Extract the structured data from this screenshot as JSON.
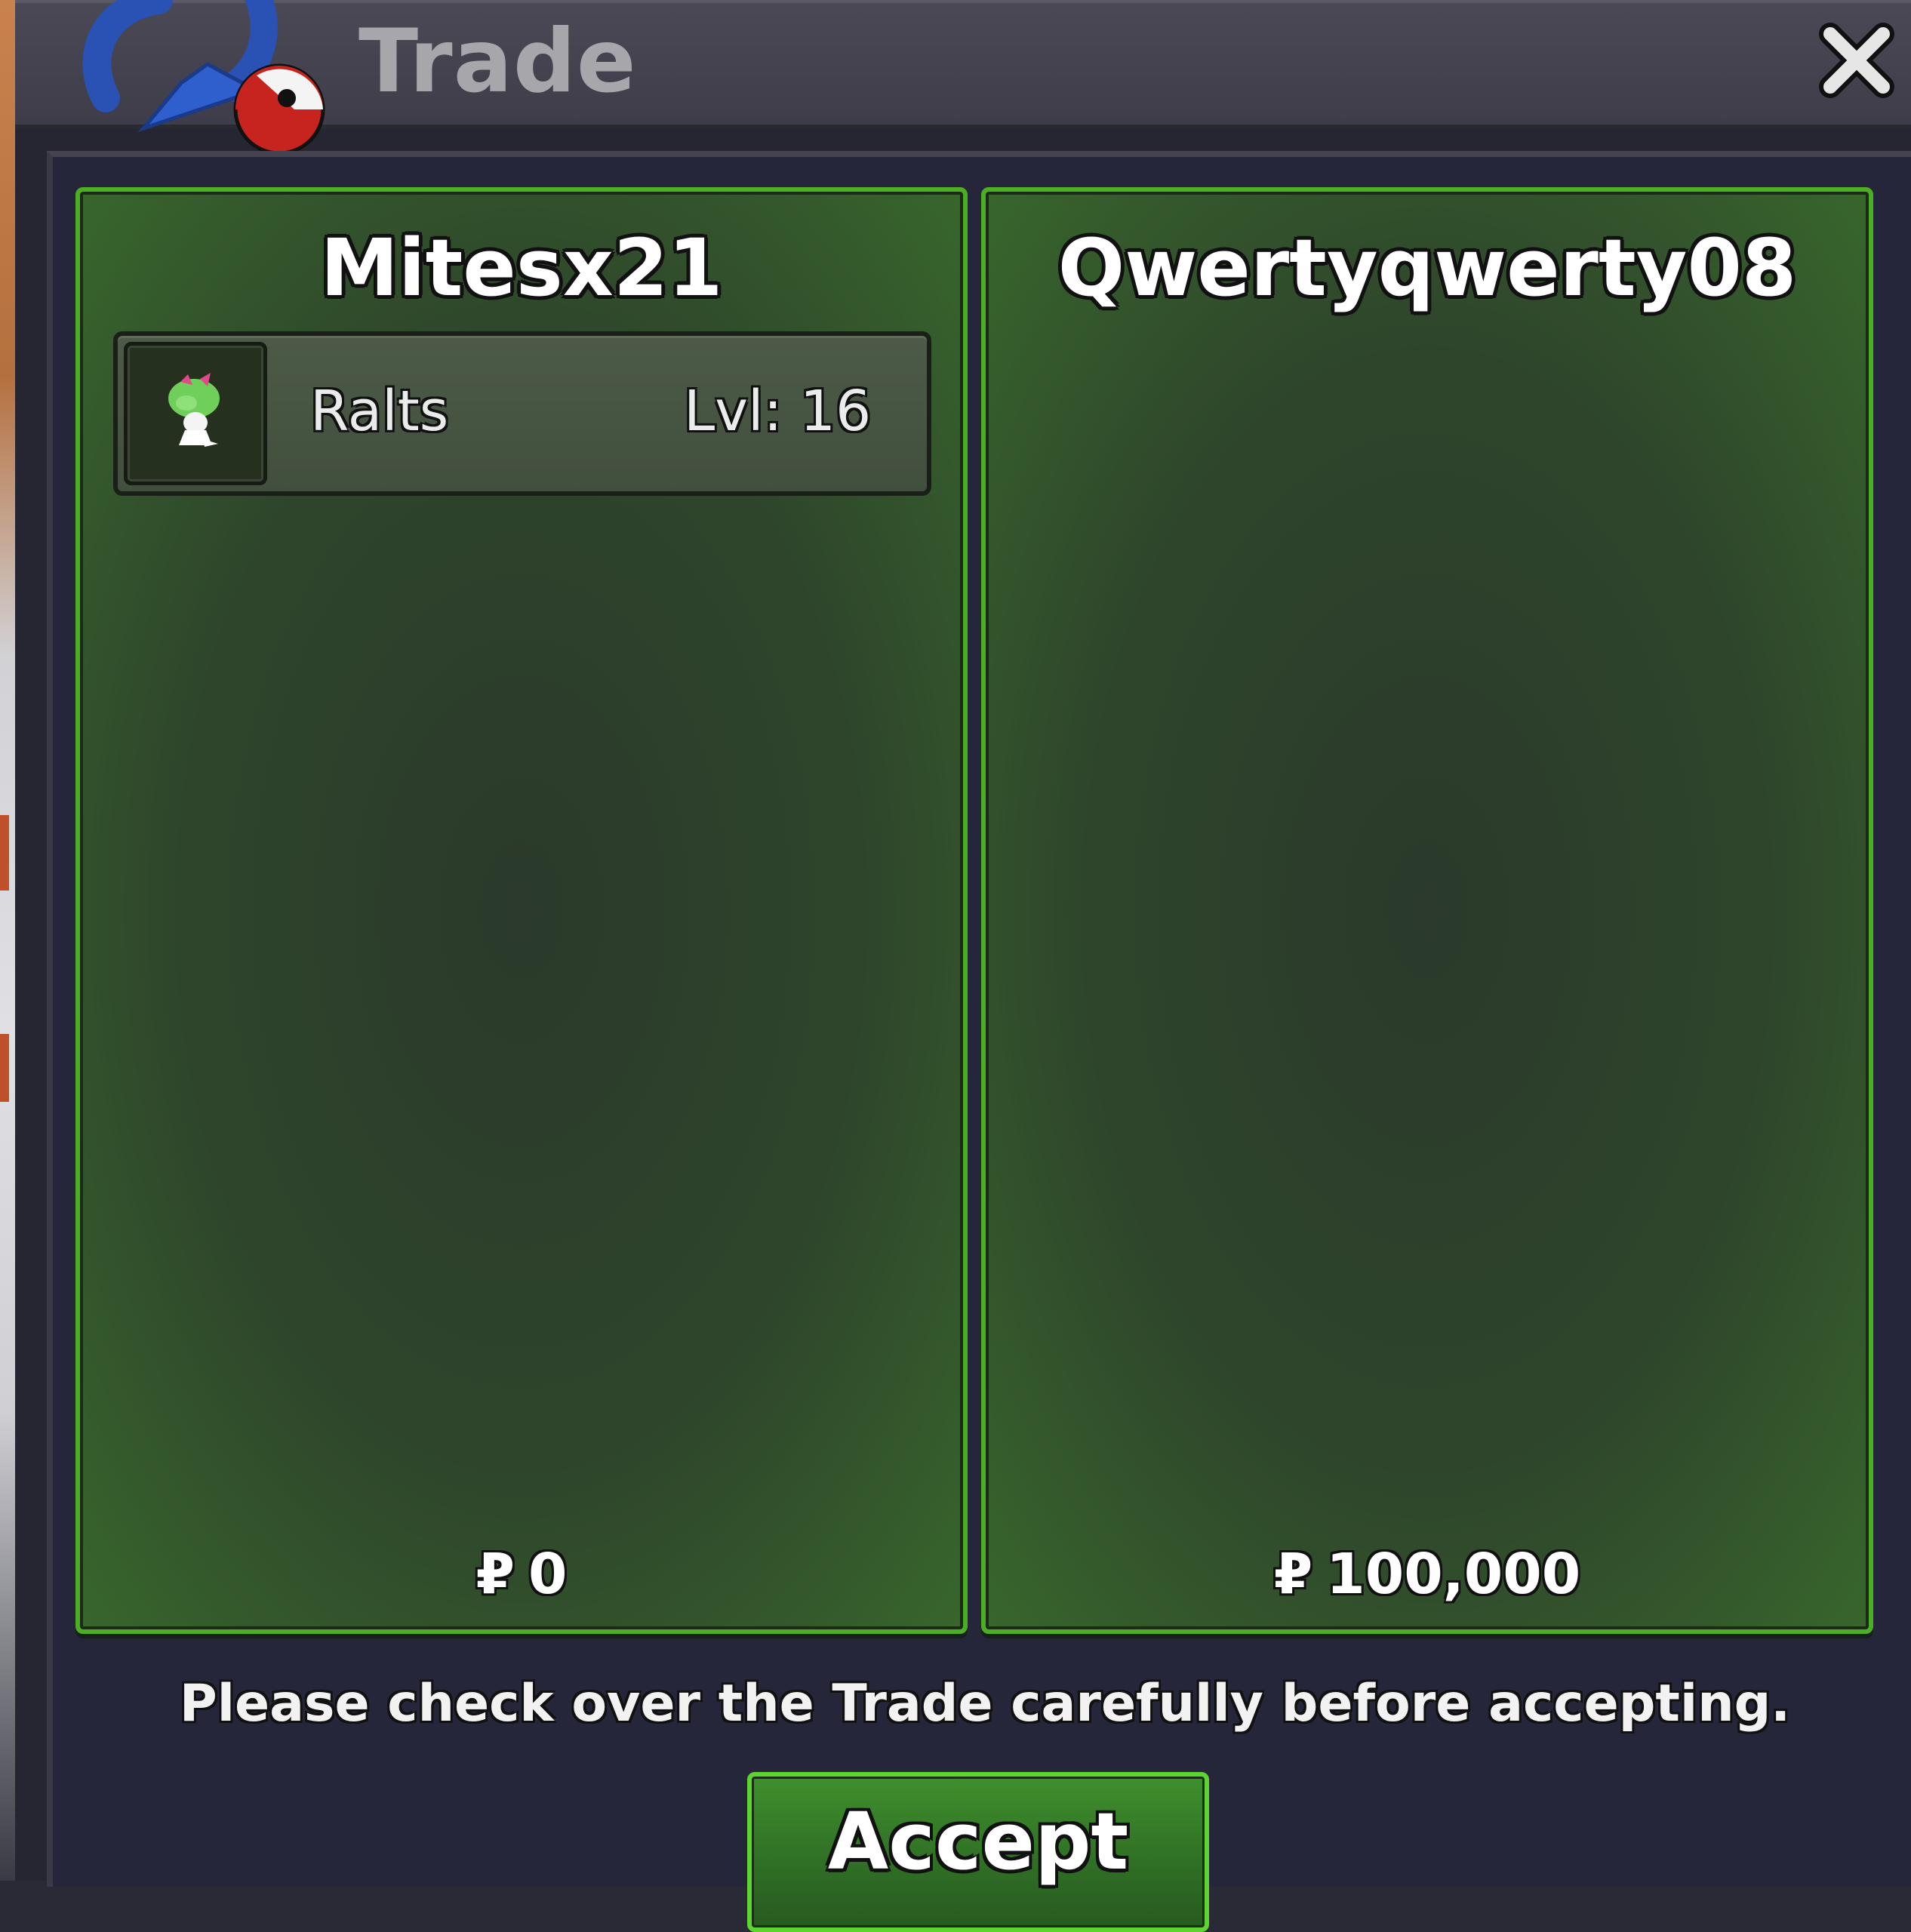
{
  "window": {
    "title": "Trade",
    "close_symbol": "✕"
  },
  "icons": {
    "trade": "trade-arrows-pokeball-icon",
    "close": "close-icon",
    "pokemon": "ralts-sprite-icon"
  },
  "trade": {
    "left": {
      "player_name": "Mitesx21",
      "pokemon": [
        {
          "name": "Ralts",
          "level": "Lvl: 16"
        }
      ],
      "currency_symbol": "₽",
      "money": "0"
    },
    "right": {
      "player_name": "Qwertyqwerty08",
      "pokemon": [],
      "currency_symbol": "₽",
      "money": "100,000"
    }
  },
  "footer": {
    "notice": "Please check over the Trade carefully before accepting.",
    "accept_label": "Accept"
  },
  "colors": {
    "panel_border": "#4caf23",
    "accept_border": "#5ed431",
    "window_bg": "#262633",
    "titlebar_bg": "#4a4955"
  }
}
